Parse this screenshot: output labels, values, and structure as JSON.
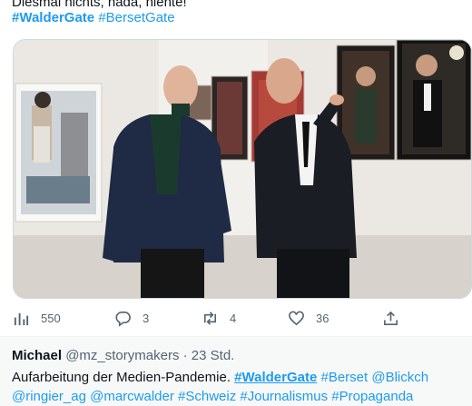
{
  "tweet": {
    "text_line": "Diesmal nichts, nada, niente!",
    "hashtags": [
      "#WalderGate",
      "#BersetGate"
    ]
  },
  "actions": {
    "views": "550",
    "replies": "3",
    "retweets": "4",
    "likes": "36"
  },
  "icons": [
    "views-icon",
    "reply-icon",
    "retweet-icon",
    "like-icon",
    "share-icon"
  ],
  "reply": {
    "name": "Michael",
    "handle": "@mz_storymakers",
    "separator": "·",
    "time": "23 Std.",
    "body_prefix": "Aufarbeitung der Medien-Pandemie.",
    "hashtag_main": "#WalderGate",
    "mention_berset": "#Berset",
    "mention_blick": "@Blickch",
    "mention_ringier": "@ringier_ag",
    "mention_marc": "@marcwalder",
    "tag_schweiz": "#Schweiz",
    "tag_journalismus": "#Journalismus",
    "tag_propaganda": "#Propaganda"
  },
  "colors": {
    "link": "#1d9bf0",
    "muted": "#536471",
    "reply_bg": "#f7f9f9"
  }
}
